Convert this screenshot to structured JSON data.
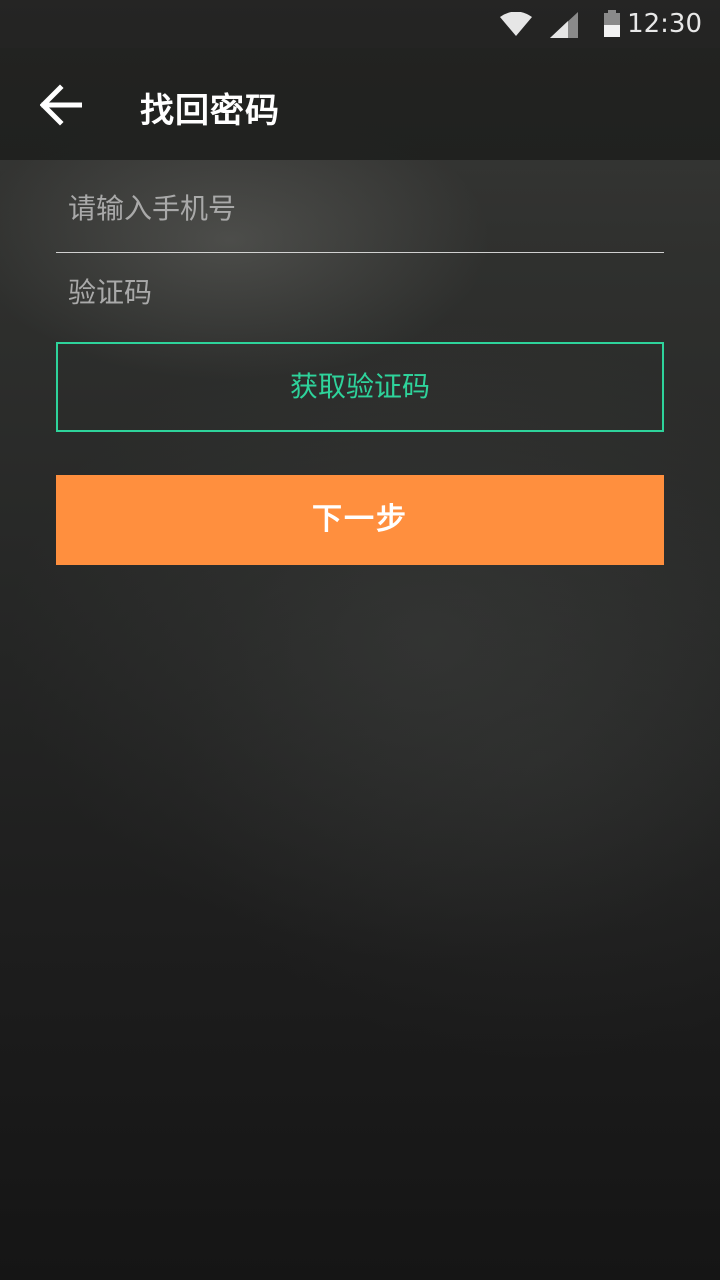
{
  "status_bar": {
    "time": "12:30",
    "icons": [
      "wifi-icon",
      "signal-icon",
      "battery-icon"
    ]
  },
  "app_bar": {
    "back_icon": "arrow-left-icon",
    "title": "找回密码"
  },
  "form": {
    "phone": {
      "value": "",
      "placeholder": "请输入手机号"
    },
    "code": {
      "value": "",
      "placeholder": "验证码"
    },
    "get_code_label": "获取验证码",
    "next_label": "下一步"
  },
  "colors": {
    "accent_green": "#2ed39b",
    "primary_orange": "#ff8f3e"
  }
}
